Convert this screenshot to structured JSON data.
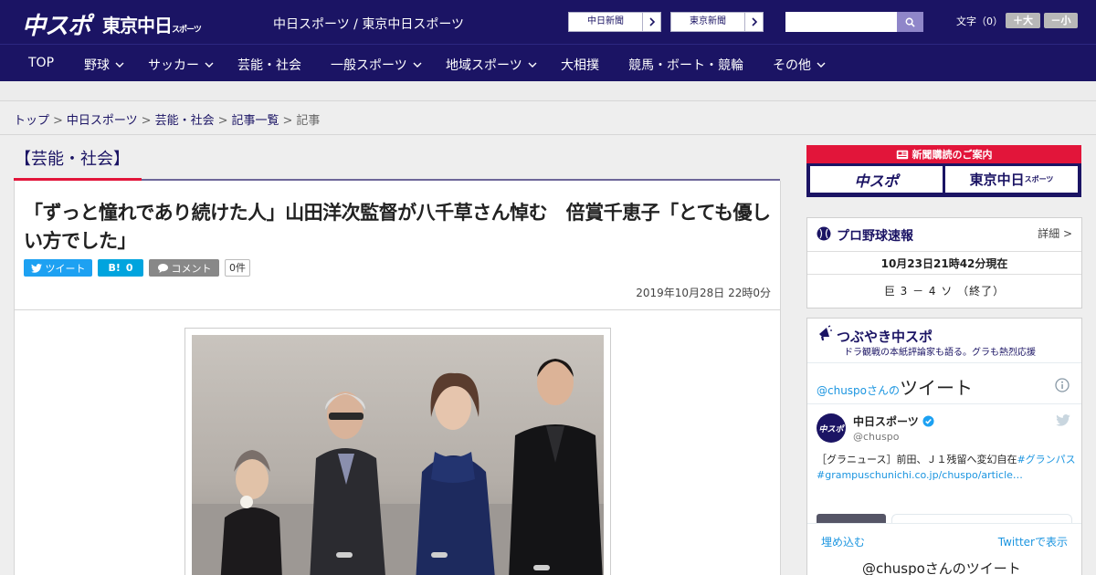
{
  "header": {
    "logo_chuspo": "中スポ",
    "logo_tokyo": "東京中日",
    "logo_tokyo_small": "スポーツ",
    "site_title": "中日スポーツ / 東京中日スポーツ",
    "ext_links": [
      "中日新聞",
      "東京新聞"
    ],
    "search": {
      "placeholder": ""
    },
    "font_size_label": "文字（0）",
    "font_bigger": "＋大",
    "font_smaller": "－小"
  },
  "nav": {
    "items": [
      {
        "label": "TOP",
        "dropdown": false
      },
      {
        "label": "野球",
        "dropdown": true
      },
      {
        "label": "サッカー",
        "dropdown": true
      },
      {
        "label": "芸能・社会",
        "dropdown": false
      },
      {
        "label": "一般スポーツ",
        "dropdown": true
      },
      {
        "label": "地域スポーツ",
        "dropdown": true
      },
      {
        "label": "大相撲",
        "dropdown": false
      },
      {
        "label": "競馬・ボート・競輪",
        "dropdown": false
      },
      {
        "label": "その他",
        "dropdown": true
      }
    ]
  },
  "breadcrumb": {
    "links": [
      "トップ",
      "中日スポーツ",
      "芸能・社会",
      "記事一覧"
    ],
    "current": "記事",
    "separator": ">"
  },
  "article": {
    "category": "【芸能・社会】",
    "headline": "「ずっと憧れであり続けた人」山田洋次監督が八千草さん悼む　倍賞千恵子「とても優しい方でした」",
    "share": {
      "tweet": "ツイート",
      "hatena_label": "B!",
      "hatena_count": "0",
      "comment": "コメント",
      "comment_count": "0件"
    },
    "date": "2019年10月28日 22時0分"
  },
  "sidebar": {
    "banner": {
      "top": "新聞購読のご案内",
      "logo_left": "中スポ",
      "logo_right": "東京中日",
      "logo_right_small": "スポーツ"
    },
    "baseball": {
      "title": "プロ野球速報",
      "more": "詳細 >",
      "time": "10月23日21時42分現在",
      "score": "巨 3 － 4 ソ （終了）"
    },
    "tsubuyaki": {
      "title": "つぶやき中スポ",
      "subtitle": "ドラ観戦の本紙評論家も語る。グラも熱烈応援",
      "tweets_by": "@chuspoさんの",
      "tweets_label": "ツイート",
      "account_name": "中日スポーツ",
      "account_handle": "@chuspo",
      "tweet_text": "［グラニュース］前田、Ｊ１残留へ変幻自在",
      "tweet_link1": "#グランパス",
      "tweet_link2": "#grampuschunichi.co.jp/chuspo/article…",
      "embed": "埋め込む",
      "view_on_twitter": "Twitterで表示",
      "next_tweets": "@chuspoさんのツイート"
    }
  },
  "colors": {
    "navy": "#1b1464",
    "red": "#e2153a",
    "twitter": "#1da1f2",
    "hatena": "#00a4de"
  }
}
